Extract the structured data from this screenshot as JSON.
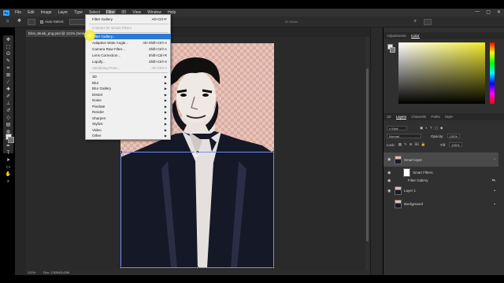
{
  "app": {
    "logo": "Ps",
    "menu": [
      "File",
      "Edit",
      "Image",
      "Layer",
      "Type",
      "Select",
      "Filter",
      "3D",
      "View",
      "Window",
      "Help"
    ],
    "active_menu": "Filter",
    "window_controls": [
      "—",
      "▢",
      "✕"
    ]
  },
  "options_bar": {
    "auto_select_label": "Auto-Select:",
    "mode_label": "3D Mode:"
  },
  "document": {
    "tab_title": "Elon_Musk_png.psd @ 121% (Smart Layer, RGB/8)",
    "zoom": "121%",
    "doc_size": "Doc: 2.52M/3.43M"
  },
  "filter_menu": {
    "last_filter": {
      "label": "Filter Gallery",
      "shortcut": "Alt+Ctrl+F"
    },
    "convert_smart": "Convert for Smart Filters",
    "items": [
      {
        "label": "Filter Gallery...",
        "shortcut": "",
        "state": "highlight"
      },
      {
        "label": "Adaptive Wide Angle...",
        "shortcut": "Alt+Shift+Ctrl+A",
        "state": "normal"
      },
      {
        "label": "Camera Raw Filter...",
        "shortcut": "Shift+Ctrl+A",
        "state": "normal"
      },
      {
        "label": "Lens Correction...",
        "shortcut": "Shift+Ctrl+R",
        "state": "normal"
      },
      {
        "label": "Liquify...",
        "shortcut": "Shift+Ctrl+X",
        "state": "normal"
      },
      {
        "label": "Vanishing Point...",
        "shortcut": "Alt+Ctrl+V",
        "state": "disabled"
      }
    ],
    "submenus": [
      "3D",
      "Blur",
      "Blur Gallery",
      "Distort",
      "Noise",
      "Pixelate",
      "Render",
      "Sharpen",
      "Stylize",
      "Video",
      "Other"
    ]
  },
  "color_panel": {
    "tabs": [
      "Adjustments",
      "Color"
    ],
    "active_tab": "Color",
    "field_hue_color": "#f2ea2a"
  },
  "layers_panel": {
    "tabs": [
      "3D",
      "Layers",
      "Channels",
      "Paths",
      "Style"
    ],
    "active_tab": "Layers",
    "kind_label": "Kind",
    "blend_mode": "Normal",
    "opacity_label": "Opacity:",
    "opacity": "100%",
    "lock_label": "Lock:",
    "fill_label": "Fill:",
    "fill": "100%",
    "layers": [
      {
        "name": "Smart layer",
        "type": "smart",
        "visible": true,
        "selected": true
      },
      {
        "name": "Smart Filters",
        "type": "filter-mask",
        "visible": true,
        "selected": false
      },
      {
        "name": "Filter Gallery",
        "type": "filter",
        "visible": true,
        "selected": false
      },
      {
        "name": "Layer 1",
        "type": "pixel",
        "visible": true,
        "selected": false
      },
      {
        "name": "Background",
        "type": "background",
        "visible": false,
        "selected": false
      }
    ]
  },
  "tools": [
    "move",
    "marquee",
    "lasso",
    "quick-select",
    "crop",
    "frame",
    "eyedropper",
    "healing",
    "brush",
    "stamp",
    "history-brush",
    "eraser",
    "gradient",
    "blur",
    "dodge",
    "pen",
    "type",
    "path-select",
    "shape",
    "hand",
    "zoom"
  ],
  "colors": {
    "accent": "#2b78d6",
    "canvas_bg": "#e8c4bb",
    "highlight_cursor": "#f3ea3c"
  }
}
